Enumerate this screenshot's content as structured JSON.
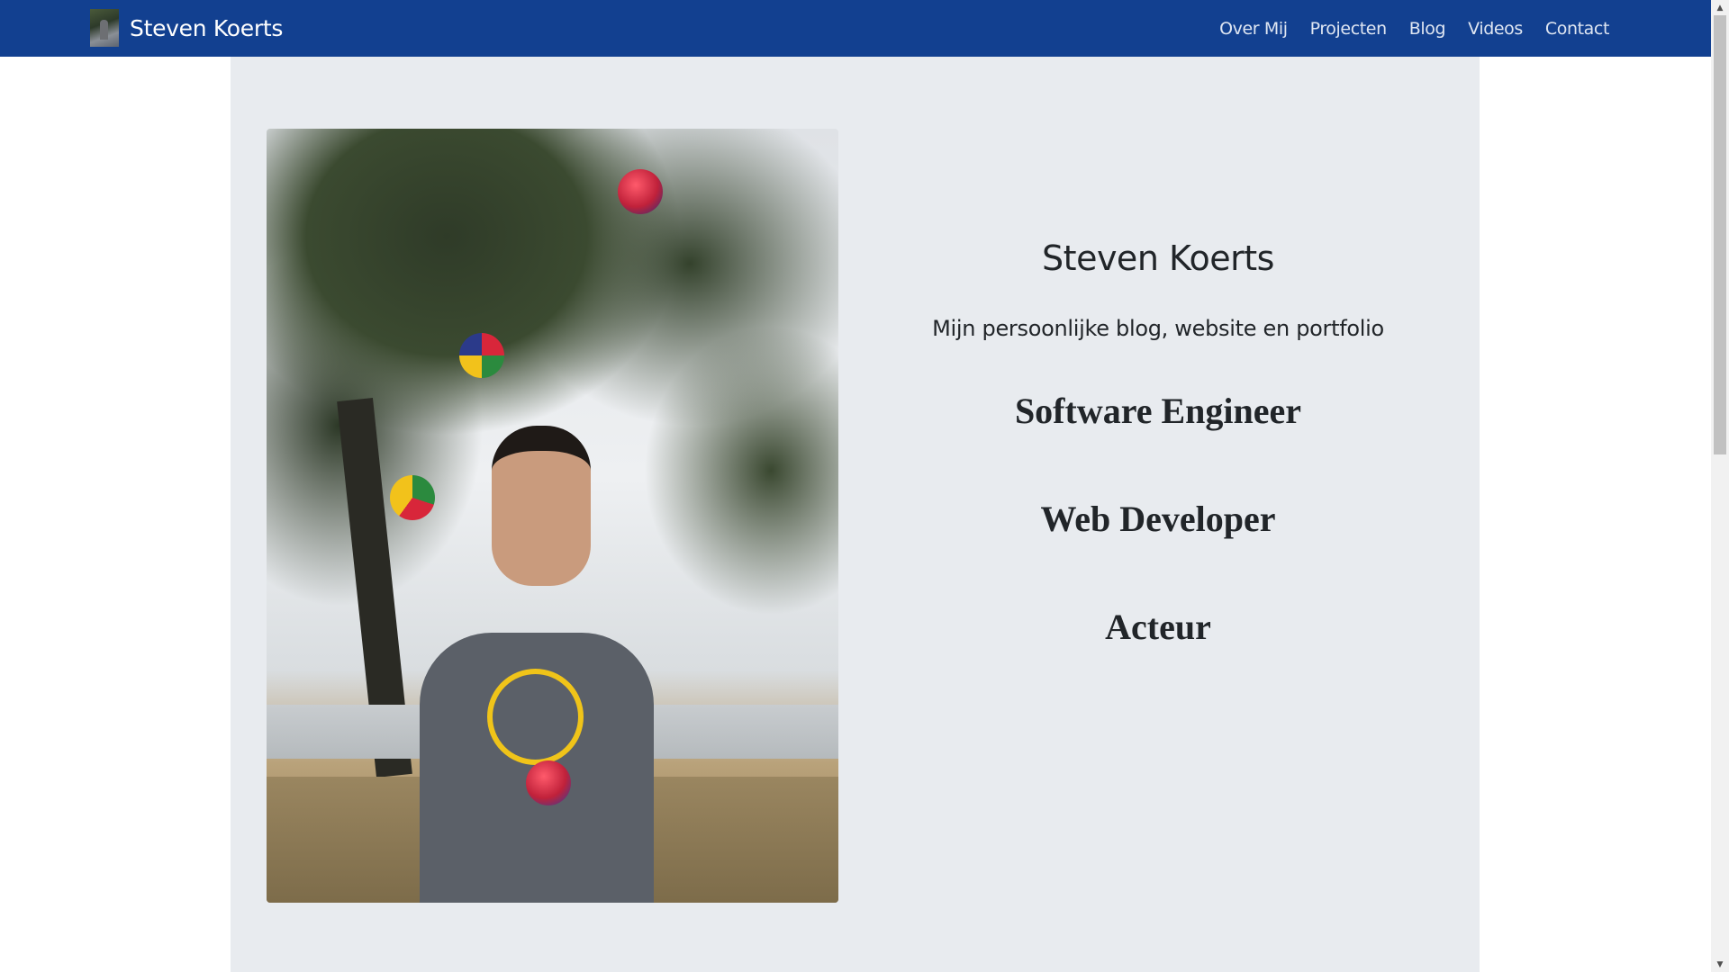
{
  "navbar": {
    "brand": "Steven Koerts",
    "links": [
      "Over Mij",
      "Projecten",
      "Blog",
      "Videos",
      "Contact"
    ],
    "background": "#124090"
  },
  "hero": {
    "title": "Steven Koerts",
    "subtitle": "Mijn persoonlijke blog, website en portfolio",
    "roles": [
      "Software Engineer",
      "Web Developer",
      "Acteur"
    ],
    "background": "#e8ebef"
  },
  "icons": {
    "scroll_up": "scroll-up-arrow-icon",
    "scroll_down": "scroll-down-arrow-icon"
  }
}
